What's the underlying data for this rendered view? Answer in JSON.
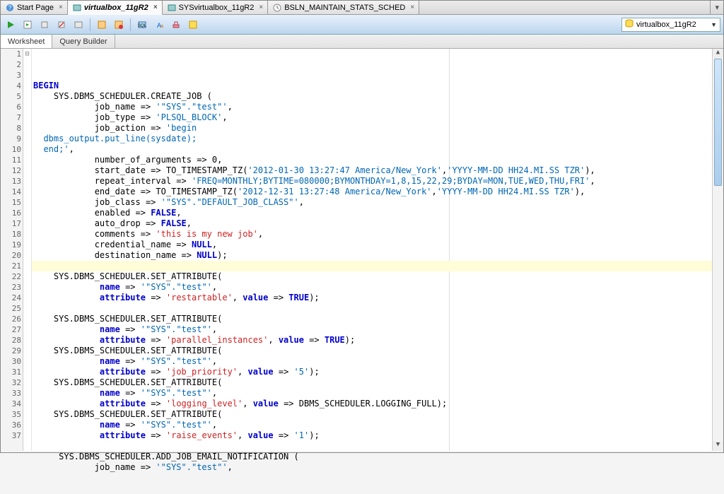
{
  "tabs": [
    {
      "label": "Start Page",
      "icon": "help"
    },
    {
      "label": "virtualbox_11gR2",
      "icon": "sql",
      "active": true
    },
    {
      "label": "SYSvirtualbox_11gR2",
      "icon": "sql"
    },
    {
      "label": "BSLN_MAINTAIN_STATS_SCHED",
      "icon": "clock"
    }
  ],
  "connection": {
    "label": "virtualbox_11gR2"
  },
  "subtabs": {
    "worksheet": "Worksheet",
    "querybuilder": "Query Builder"
  },
  "code": [
    {
      "n": 1,
      "fold": "⊟",
      "html": "<span class='kw'>BEGIN</span>"
    },
    {
      "n": 2,
      "html": "    SYS.DBMS_SCHEDULER.CREATE_JOB ("
    },
    {
      "n": 3,
      "html": "            job_name <span class='op'>=&gt;</span> <span class='str'>'\"SYS\".\"test\"'</span>,"
    },
    {
      "n": 4,
      "html": "            job_type <span class='op'>=&gt;</span> <span class='str'>'PLSQL_BLOCK'</span>,"
    },
    {
      "n": 5,
      "html": "            job_action <span class='op'>=&gt;</span> <span class='str'>'begin</span>"
    },
    {
      "n": 6,
      "html": "<span class='str'>  dbms_output.put_line(sysdate);</span>"
    },
    {
      "n": 7,
      "html": "<span class='str'>  end;'</span>,"
    },
    {
      "n": 8,
      "html": "            number_of_arguments <span class='op'>=&gt;</span> 0,"
    },
    {
      "n": 9,
      "html": "            start_date <span class='op'>=&gt;</span> TO_TIMESTAMP_TZ(<span class='str'>'2012-01-30 13:27:47 America/New_York'</span>,<span class='str'>'YYYY-MM-DD HH24.MI.SS TZR'</span>),"
    },
    {
      "n": 10,
      "html": "            repeat_interval <span class='op'>=&gt;</span> <span class='str'>'FREQ=MONTHLY;BYTIME=080000;BYMONTHDAY=1,8,15,22,29;BYDAY=MON,TUE,WED,THU,FRI'</span>,"
    },
    {
      "n": 11,
      "html": "            end_date <span class='op'>=&gt;</span> TO_TIMESTAMP_TZ(<span class='str'>'2012-12-31 13:27:48 America/New_York'</span>,<span class='str'>'YYYY-MM-DD HH24.MI.SS TZR'</span>),"
    },
    {
      "n": 12,
      "html": "            job_class <span class='op'>=&gt;</span> <span class='str'>'\"SYS\".\"DEFAULT_JOB_CLASS\"'</span>,"
    },
    {
      "n": 13,
      "html": "            enabled <span class='op'>=&gt;</span> <span class='kw'>FALSE</span>,"
    },
    {
      "n": 14,
      "html": "            auto_drop <span class='op'>=&gt;</span> <span class='kw'>FALSE</span>,"
    },
    {
      "n": 15,
      "html": "            comments <span class='op'>=&gt;</span> <span class='strred'>'this is my new job'</span>,"
    },
    {
      "n": 16,
      "html": "            credential_name <span class='op'>=&gt;</span> <span class='kw'>NULL</span>,"
    },
    {
      "n": 17,
      "html": "            destination_name <span class='op'>=&gt;</span> <span class='kw'>NULL</span>);"
    },
    {
      "n": 18,
      "hl": true,
      "html": " "
    },
    {
      "n": 19,
      "html": "    SYS.DBMS_SCHEDULER.SET_ATTRIBUTE("
    },
    {
      "n": 20,
      "html": "             <span class='kw'>name</span> <span class='op'>=&gt;</span> <span class='str'>'\"SYS\".\"test\"'</span>,"
    },
    {
      "n": 21,
      "html": "             <span class='kw'>attribute</span> <span class='op'>=&gt;</span> <span class='strred'>'restartable'</span>, <span class='kw'>value</span> <span class='op'>=&gt;</span> <span class='kw'>TRUE</span>);"
    },
    {
      "n": 22,
      "html": " "
    },
    {
      "n": 23,
      "html": "    SYS.DBMS_SCHEDULER.SET_ATTRIBUTE("
    },
    {
      "n": 24,
      "html": "             <span class='kw'>name</span> <span class='op'>=&gt;</span> <span class='str'>'\"SYS\".\"test\"'</span>,"
    },
    {
      "n": 25,
      "html": "             <span class='kw'>attribute</span> <span class='op'>=&gt;</span> <span class='strred'>'parallel_instances'</span>, <span class='kw'>value</span> <span class='op'>=&gt;</span> <span class='kw'>TRUE</span>);"
    },
    {
      "n": 26,
      "html": "    SYS.DBMS_SCHEDULER.SET_ATTRIBUTE("
    },
    {
      "n": 27,
      "html": "             <span class='kw'>name</span> <span class='op'>=&gt;</span> <span class='str'>'\"SYS\".\"test\"'</span>,"
    },
    {
      "n": 28,
      "html": "             <span class='kw'>attribute</span> <span class='op'>=&gt;</span> <span class='strred'>'job_priority'</span>, <span class='kw'>value</span> <span class='op'>=&gt;</span> <span class='str'>'5'</span>);"
    },
    {
      "n": 29,
      "html": "    SYS.DBMS_SCHEDULER.SET_ATTRIBUTE("
    },
    {
      "n": 30,
      "html": "             <span class='kw'>name</span> <span class='op'>=&gt;</span> <span class='str'>'\"SYS\".\"test\"'</span>,"
    },
    {
      "n": 31,
      "html": "             <span class='kw'>attribute</span> <span class='op'>=&gt;</span> <span class='strred'>'logging_level'</span>, <span class='kw'>value</span> <span class='op'>=&gt;</span> DBMS_SCHEDULER.LOGGING_FULL);"
    },
    {
      "n": 32,
      "html": "    SYS.DBMS_SCHEDULER.SET_ATTRIBUTE("
    },
    {
      "n": 33,
      "html": "             <span class='kw'>name</span> <span class='op'>=&gt;</span> <span class='str'>'\"SYS\".\"test\"'</span>,"
    },
    {
      "n": 34,
      "html": "             <span class='kw'>attribute</span> <span class='op'>=&gt;</span> <span class='strred'>'raise_events'</span>, <span class='kw'>value</span> <span class='op'>=&gt;</span> <span class='str'>'1'</span>);"
    },
    {
      "n": 35,
      "html": " "
    },
    {
      "n": 36,
      "html": "     SYS.DBMS_SCHEDULER.ADD_JOB_EMAIL_NOTIFICATION ("
    },
    {
      "n": 37,
      "html": "            job_name <span class='op'>=&gt;</span> <span class='str'>'\"SYS\".\"test\"'</span>,"
    }
  ]
}
